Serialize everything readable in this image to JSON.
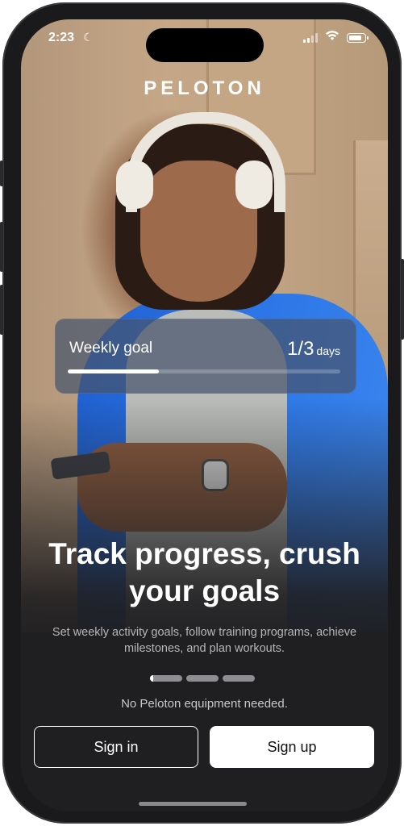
{
  "status_bar": {
    "time": "2:23",
    "focus_icon": "moon-icon",
    "signal_icon": "cellular-signal-icon",
    "wifi_icon": "wifi-icon",
    "battery_icon": "battery-icon",
    "battery_level": 0.85
  },
  "brand": {
    "logo_text": "PELOTON"
  },
  "hero": {
    "image": "photo of man wearing headphones and blue jacket looking at phone"
  },
  "goal_card": {
    "label": "Weekly goal",
    "count": "1/3",
    "unit": "days",
    "progress": 0.333
  },
  "onboarding": {
    "headline": "Track progress, crush your goals",
    "description": "Set weekly activity goals, follow training programs, achieve milestones, and plan workouts.",
    "pager": {
      "pages": 3,
      "current_index": 0,
      "current_progress": 0.1
    },
    "note": "No Peloton equipment needed."
  },
  "actions": {
    "sign_in_label": "Sign in",
    "sign_up_label": "Sign up"
  },
  "colors": {
    "background": "#1f1e20",
    "accent_blue": "#2a74e6",
    "button_primary_bg": "#ffffff",
    "text_secondary": "#b6b6b8"
  }
}
